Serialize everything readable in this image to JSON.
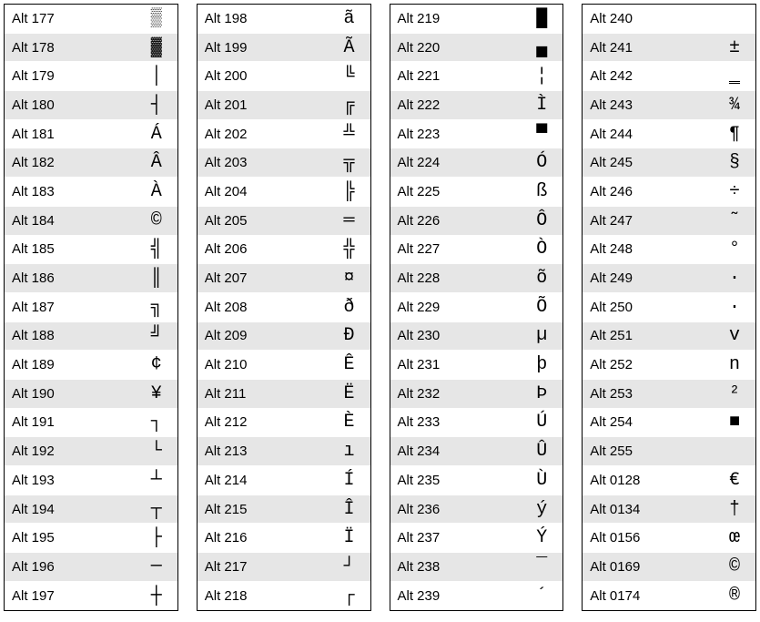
{
  "columns": [
    [
      {
        "code": "Alt 177",
        "symbol": "▒"
      },
      {
        "code": "Alt 178",
        "symbol": "▓"
      },
      {
        "code": "Alt 179",
        "symbol": "│"
      },
      {
        "code": "Alt 180",
        "symbol": "┤"
      },
      {
        "code": "Alt 181",
        "symbol": "Á"
      },
      {
        "code": "Alt 182",
        "symbol": "Â"
      },
      {
        "code": "Alt 183",
        "symbol": "À"
      },
      {
        "code": "Alt 184",
        "symbol": "©"
      },
      {
        "code": "Alt 185",
        "symbol": "╣"
      },
      {
        "code": "Alt 186",
        "symbol": "║"
      },
      {
        "code": "Alt 187",
        "symbol": "╗"
      },
      {
        "code": "Alt 188",
        "symbol": "╝"
      },
      {
        "code": "Alt 189",
        "symbol": "¢"
      },
      {
        "code": "Alt 190",
        "symbol": "¥"
      },
      {
        "code": "Alt 191",
        "symbol": "┐"
      },
      {
        "code": "Alt 192",
        "symbol": "└"
      },
      {
        "code": "Alt 193",
        "symbol": "┴"
      },
      {
        "code": "Alt 194",
        "symbol": "┬"
      },
      {
        "code": "Alt 195",
        "symbol": "├"
      },
      {
        "code": "Alt 196",
        "symbol": "─"
      },
      {
        "code": "Alt 197",
        "symbol": "┼"
      }
    ],
    [
      {
        "code": "Alt 198",
        "symbol": "ã"
      },
      {
        "code": "Alt 199",
        "symbol": "Ã"
      },
      {
        "code": "Alt 200",
        "symbol": "╚"
      },
      {
        "code": "Alt 201",
        "symbol": "╔"
      },
      {
        "code": "Alt 202",
        "symbol": "╩"
      },
      {
        "code": "Alt 203",
        "symbol": "╦"
      },
      {
        "code": "Alt 204",
        "symbol": "╠"
      },
      {
        "code": "Alt 205",
        "symbol": "═"
      },
      {
        "code": "Alt 206",
        "symbol": "╬"
      },
      {
        "code": "Alt 207",
        "symbol": "¤"
      },
      {
        "code": "Alt 208",
        "symbol": "ð"
      },
      {
        "code": "Alt 209",
        "symbol": "Ð"
      },
      {
        "code": "Alt 210",
        "symbol": "Ê"
      },
      {
        "code": "Alt 211",
        "symbol": "Ë"
      },
      {
        "code": "Alt 212",
        "symbol": "È"
      },
      {
        "code": "Alt 213",
        "symbol": "ı"
      },
      {
        "code": "Alt 214",
        "symbol": "Í"
      },
      {
        "code": "Alt 215",
        "symbol": "Î"
      },
      {
        "code": "Alt 216",
        "symbol": "Ï"
      },
      {
        "code": "Alt 217",
        "symbol": "┘"
      },
      {
        "code": "Alt 218",
        "symbol": "┌"
      }
    ],
    [
      {
        "code": "Alt 219",
        "symbol": "█"
      },
      {
        "code": "Alt 220",
        "symbol": "▄"
      },
      {
        "code": "Alt 221",
        "symbol": "¦"
      },
      {
        "code": "Alt 222",
        "symbol": "Ì"
      },
      {
        "code": "Alt 223",
        "symbol": "▀"
      },
      {
        "code": "Alt 224",
        "symbol": "Ó"
      },
      {
        "code": "Alt 225",
        "symbol": "ß"
      },
      {
        "code": "Alt 226",
        "symbol": "Ô"
      },
      {
        "code": "Alt 227",
        "symbol": "Ò"
      },
      {
        "code": "Alt 228",
        "symbol": "õ"
      },
      {
        "code": "Alt 229",
        "symbol": "Õ"
      },
      {
        "code": "Alt 230",
        "symbol": "µ"
      },
      {
        "code": "Alt 231",
        "symbol": "þ"
      },
      {
        "code": "Alt 232",
        "symbol": "Þ"
      },
      {
        "code": "Alt 233",
        "symbol": "Ú"
      },
      {
        "code": "Alt 234",
        "symbol": "Û"
      },
      {
        "code": "Alt 235",
        "symbol": "Ù"
      },
      {
        "code": "Alt 236",
        "symbol": "ý"
      },
      {
        "code": "Alt 237",
        "symbol": "Ý"
      },
      {
        "code": "Alt 238",
        "symbol": "¯"
      },
      {
        "code": "Alt 239",
        "symbol": "´"
      }
    ],
    [
      {
        "code": "Alt 240",
        "symbol": ""
      },
      {
        "code": "Alt 241",
        "symbol": "±"
      },
      {
        "code": "Alt 242",
        "symbol": "‗"
      },
      {
        "code": "Alt 243",
        "symbol": "¾"
      },
      {
        "code": "Alt 244",
        "symbol": "¶"
      },
      {
        "code": "Alt 245",
        "symbol": "§"
      },
      {
        "code": "Alt 246",
        "symbol": "÷"
      },
      {
        "code": "Alt 247",
        "symbol": "˜"
      },
      {
        "code": "Alt 248",
        "symbol": "°"
      },
      {
        "code": "Alt 249",
        "symbol": "·"
      },
      {
        "code": "Alt 250",
        "symbol": "·"
      },
      {
        "code": "Alt 251",
        "symbol": "v"
      },
      {
        "code": "Alt 252",
        "symbol": "n"
      },
      {
        "code": "Alt 253",
        "symbol": "²"
      },
      {
        "code": "Alt 254",
        "symbol": "■"
      },
      {
        "code": "Alt 255",
        "symbol": ""
      },
      {
        "code": "Alt 0128",
        "symbol": "€"
      },
      {
        "code": "Alt 0134",
        "symbol": "†"
      },
      {
        "code": "Alt 0156",
        "symbol": "œ"
      },
      {
        "code": "Alt 0169",
        "symbol": "©"
      },
      {
        "code": "Alt 0174",
        "symbol": "®"
      }
    ]
  ]
}
